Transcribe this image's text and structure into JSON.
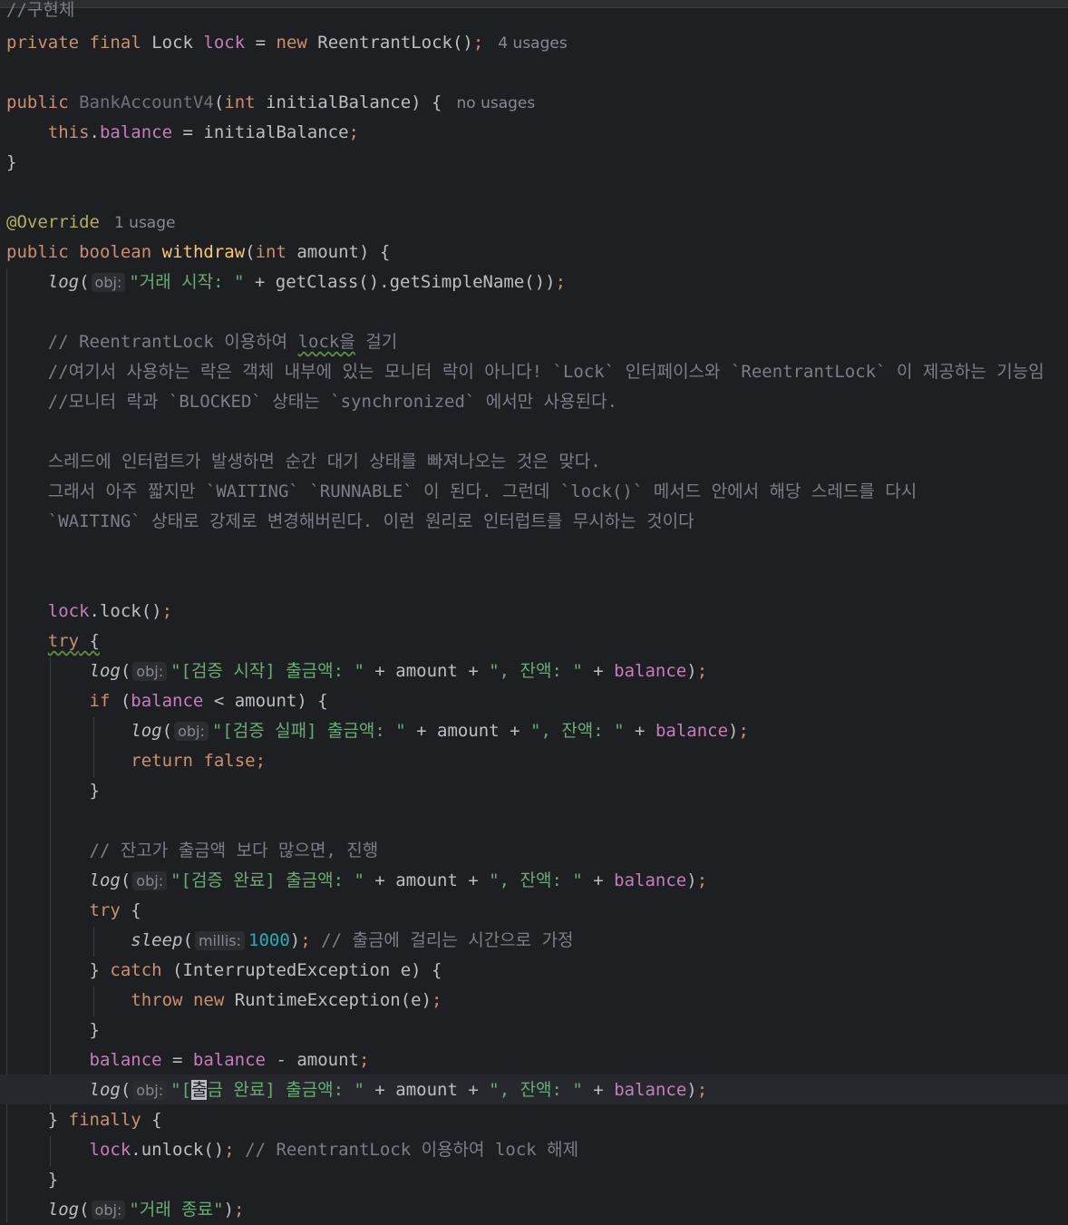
{
  "hints": {
    "obj": "obj:",
    "millis": "millis:"
  },
  "usages": {
    "lock_field": "4 usages",
    "constructor": "no usages",
    "withdraw": "1 usage"
  },
  "code": {
    "l0": "//구현체",
    "l1_private": "private",
    "l1_final": "final",
    "l1_type": "Lock",
    "l1_name": "lock",
    "l1_eq": " = ",
    "l1_new": "new",
    "l1_ctor": "ReentrantLock()",
    "l1_semi": ";",
    "l2_public": "public",
    "l2_name": "BankAccountV4",
    "l2_paren": "(",
    "l2_int": "int",
    "l2_param": " initialBalance) {",
    "l3_this": "this",
    "l3_dot": ".",
    "l3_field": "balance",
    "l3_rest": " = initialBalance",
    "l3_semi": ";",
    "l4": "}",
    "l5_ann": "@Override",
    "l6_public": "public",
    "l6_boolean": "boolean",
    "l6_name": "withdraw",
    "l6_paren": "(",
    "l6_int": "int",
    "l6_rest": " amount) {",
    "l7_log": "log",
    "l7_open": "(",
    "l7_str": "\"거래 시작: \"",
    "l7_rest": " + getClass().getSimpleName())",
    "l7_semi": ";",
    "c1_prefix": "// ReentrantLock 이용하여 ",
    "c1_lock": "lock을",
    "c1_suffix": " 걸기",
    "c2": "//여기서 사용하는 락은 객체 내부에 있는 모니터 락이 아니다! `Lock` 인터페이스와 `ReentrantLock` 이 제공하는 기능임",
    "c3": "//모니터 락과 `BLOCKED` 상태는 `synchronized` 에서만 사용된다.",
    "c4": "스레드에 인터럽트가 발생하면 순간 대기 상태를 빠져나오는 것은 맞다.",
    "c5": "그래서 아주 짧지만 `WAITING` `RUNNABLE` 이 된다. 그런데 `lock()` 메서드 안에서 해당 스레드를 다시",
    "c6": "`WAITING` 상태로 강제로 변경해버린다. 이런 원리로 인터럽트를 무시하는 것이다",
    "l8_lock": "lock",
    "l8_call": ".lock()",
    "l8_semi": ";",
    "l9_try": "try",
    "l9_brace": " {",
    "v_log": "log",
    "v_open": "(",
    "v_str1": "\"[검증 시작] 출금액: \"",
    "v_plus_amount": " + amount + ",
    "v_str2": "\", 잔액: \"",
    "v_plus": " + ",
    "v_balance": "balance",
    "v_close": ")",
    "v_semi": ";",
    "if_kw": "if",
    "if_open": " (",
    "if_balance": "balance",
    "if_rest": " < amount) {",
    "f_str1": "\"[검증 실패] 출금액: \"",
    "ret_kw": "return",
    "ret_false": "false",
    "ret_semi": ";",
    "close_brace": "}",
    "cmt_enough": "// 잔고가 출금액 보다 많으면, 진행",
    "ok_str1": "\"[검증 완료] 출금액: \"",
    "try2": "try",
    "try2_brace": " {",
    "sleep": "sleep",
    "sleep_open": "(",
    "sleep_val": "1000",
    "sleep_close": ")",
    "sleep_semi": ";",
    "sleep_cmt": " // 출금에 걸리는 시간으로 가정",
    "catch_open": "} ",
    "catch_kw": "catch",
    "catch_rest": " (InterruptedException e) {",
    "throw_kw": "throw",
    "throw_new": "new",
    "throw_rest": " RuntimeException(e)",
    "throw_semi": ";",
    "bal_lhs": "balance",
    "bal_eq": " = ",
    "bal_rhs": "balance",
    "bal_rest": " - amount",
    "bal_semi": ";",
    "done_q": "\"[",
    "done_caret": "출",
    "done_rest": "금 완료] 출금액: \"",
    "fin_open": "} ",
    "fin_kw": "finally",
    "fin_brace": " {",
    "unlock_lock": "lock",
    "unlock_call": ".unlock()",
    "unlock_semi": ";",
    "unlock_cmt": " // ReentrantLock 이용하여 lock 해제",
    "end_str": "\"거래 종료\"",
    "end_close": ")",
    "end_semi": ";"
  }
}
